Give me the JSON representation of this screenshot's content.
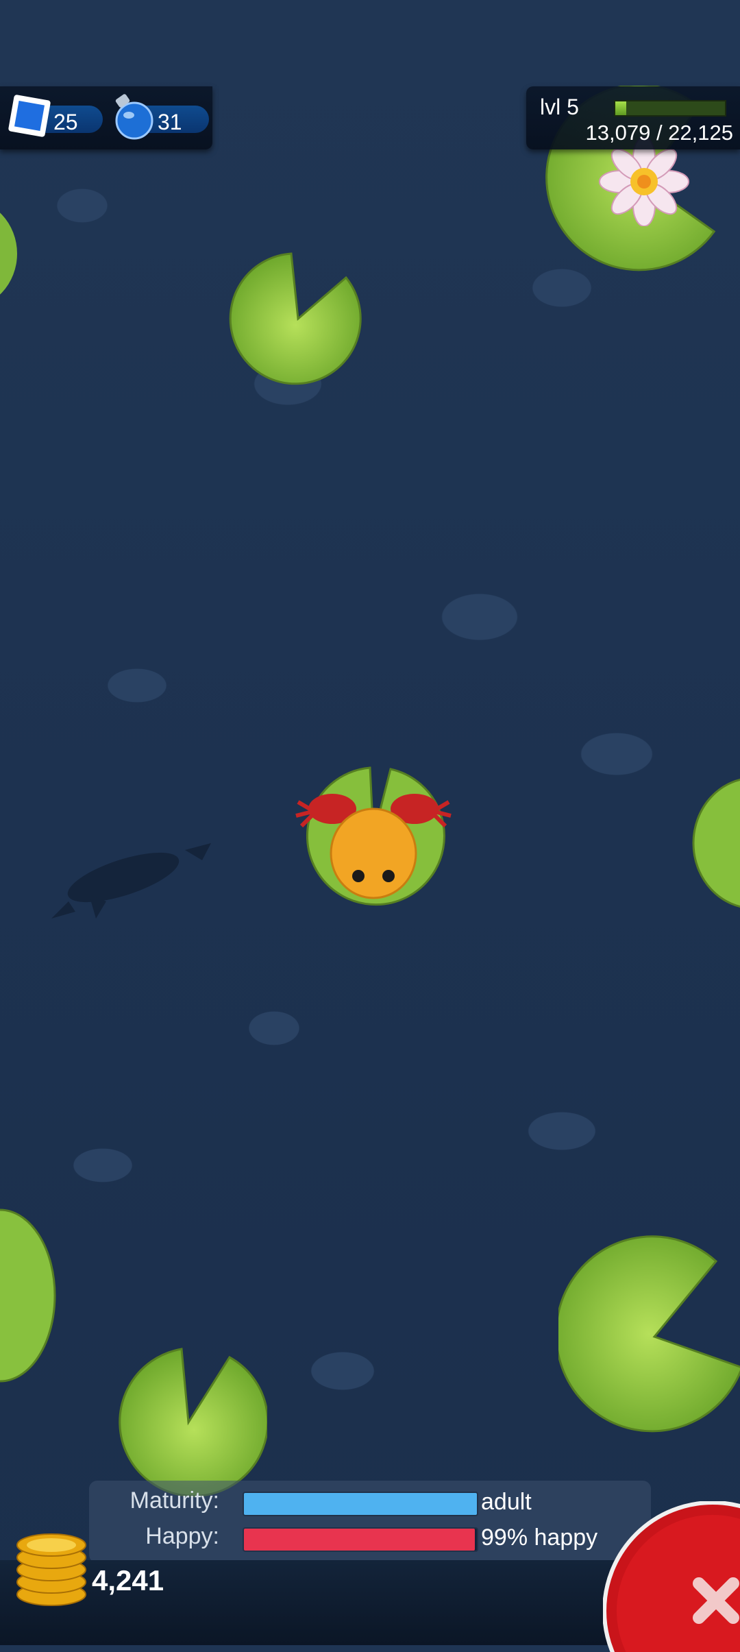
{
  "hud": {
    "stamps": "25",
    "potions": "31",
    "level": "lvl 5",
    "xp_text": "13,079 / 22,125",
    "xp_progress": 0.1
  },
  "status": {
    "maturity_label": "Maturity:",
    "maturity_value": "adult",
    "maturity_progress": 1.0,
    "maturity_color": "#4fb2f0",
    "happy_label": "Happy:",
    "happy_value": "99% happy",
    "happy_progress": 0.99,
    "happy_color": "#e8344f"
  },
  "coins": "4,241",
  "icons": {
    "stamp": "stamp-icon",
    "potion": "potion-icon",
    "coins": "coin-stack-icon",
    "close": "close-icon",
    "lily": "lotus-flower-icon",
    "frog": "frog",
    "fish": "fish-shadow"
  }
}
